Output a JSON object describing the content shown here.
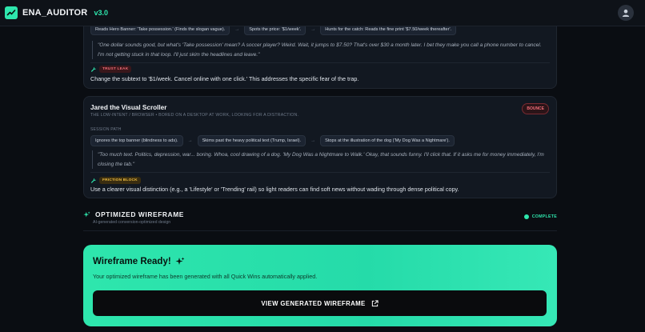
{
  "app": {
    "name": "ENA_AUDITOR",
    "version": "v3.0"
  },
  "persona_prev": {
    "path": [
      "Reads Hero Banner: 'Take possession.' (Finds the slogan vague).",
      "Spots the price: '$1/week'.",
      "Hunts for the catch: Reads the fine print '$7.50/week thereafter'."
    ],
    "quote": "\"One dollar sounds good, but what's 'Take possession' mean? A soccer player? Weird. Wait, it jumps to $7.50? That's over $30 a month later. I bet they make you call a phone number to cancel. I'm not getting stuck in that loop. I'll just skim the headlines and leave.\"",
    "tag": "TRUST LEAK",
    "fix": "Change the subtext to '$1/week. Cancel online with one click.' This addresses the specific fear of the trap."
  },
  "persona": {
    "name": "Jared the Visual Scroller",
    "subtitle": "THE LOW-INTENT / BROWSER • BORED ON A DESKTOP AT WORK, LOOKING FOR A DISTRACTION.",
    "badge": "BOUNCE",
    "session_label": "SESSION PATH",
    "path": [
      "Ignores the top banner (blindness to ads).",
      "Skims past the heavy political text (Trump, Israel).",
      "Stops at the illustration of the dog ('My Dog Was a Nightmare')."
    ],
    "quote": "\"Too much text. Politics, depression, war... boring. Whoa, cool drawing of a dog. 'My Dog Was a Nightmare to Walk.' Okay, that sounds funny. I'll click that. If it asks me for money immediately, I'm closing the tab.\"",
    "tag": "FRICTION BLOCK",
    "fix": "Use a clearer visual distinction (e.g., a 'Lifestyle' or 'Trending' rail) so light readers can find soft news without wading through dense political copy."
  },
  "optimized": {
    "title": "OPTIMIZED WIREFRAME",
    "subtitle": "AI-generated conversion-optimized design",
    "status": "COMPLETE"
  },
  "ready": {
    "title": "Wireframe Ready!",
    "description": "Your optimized wireframe has been generated with all Quick Wins automatically applied.",
    "button": "VIEW GENERATED WIREFRAME"
  },
  "colors": {
    "accent": "#2ee6ad",
    "danger": "#f26d78",
    "warning": "#f1bf41",
    "background": "#0a0d12",
    "card": "#121821"
  },
  "icons": [
    "chart-logo-icon",
    "user-icon",
    "wrench-icon",
    "sparkles-icon",
    "external-link-icon"
  ]
}
